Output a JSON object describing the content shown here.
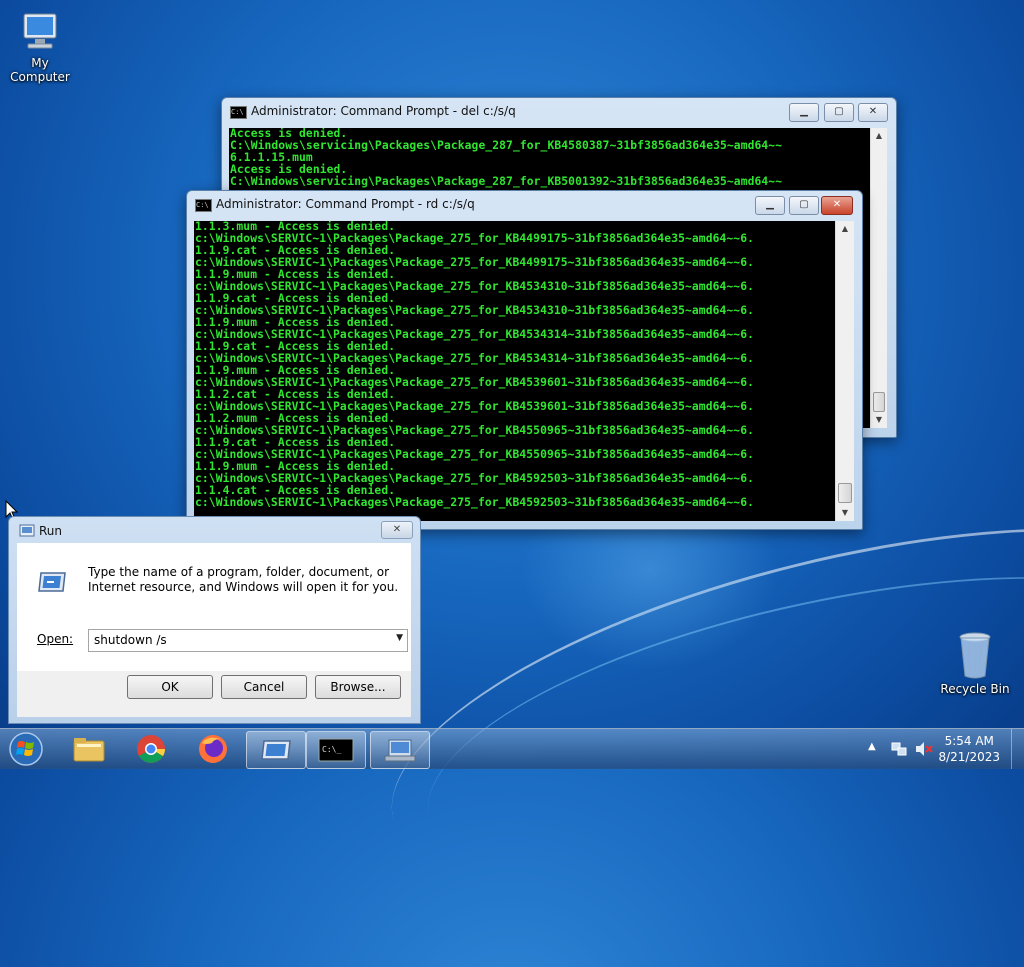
{
  "desktop": {
    "icons": {
      "my_computer": "My Computer",
      "recycle_bin": "Recycle Bin"
    }
  },
  "back_console": {
    "title": "Administrator:  Command Prompt - del  c:/s/q",
    "lines": [
      "Access is denied.",
      "C:\\Windows\\servicing\\Packages\\Package_287_for_KB4580387~31bf3856ad364e35~amd64~~",
      "6.1.1.15.mum",
      "Access is denied.",
      "C:\\Windows\\servicing\\Packages\\Package_287_for_KB5001392~31bf3856ad364e35~amd64~~"
    ]
  },
  "front_console": {
    "title": "Administrator:  Command Prompt - rd  c:/s/q",
    "lines": [
      "1.1.3.mum - Access is denied.",
      "c:\\Windows\\SERVIC~1\\Packages\\Package_275_for_KB4499175~31bf3856ad364e35~amd64~~6.",
      "1.1.9.cat - Access is denied.",
      "c:\\Windows\\SERVIC~1\\Packages\\Package_275_for_KB4499175~31bf3856ad364e35~amd64~~6.",
      "1.1.9.mum - Access is denied.",
      "c:\\Windows\\SERVIC~1\\Packages\\Package_275_for_KB4534310~31bf3856ad364e35~amd64~~6.",
      "1.1.9.cat - Access is denied.",
      "c:\\Windows\\SERVIC~1\\Packages\\Package_275_for_KB4534310~31bf3856ad364e35~amd64~~6.",
      "1.1.9.mum - Access is denied.",
      "c:\\Windows\\SERVIC~1\\Packages\\Package_275_for_KB4534314~31bf3856ad364e35~amd64~~6.",
      "1.1.9.cat - Access is denied.",
      "c:\\Windows\\SERVIC~1\\Packages\\Package_275_for_KB4534314~31bf3856ad364e35~amd64~~6.",
      "1.1.9.mum - Access is denied.",
      "c:\\Windows\\SERVIC~1\\Packages\\Package_275_for_KB4539601~31bf3856ad364e35~amd64~~6.",
      "1.1.2.cat - Access is denied.",
      "c:\\Windows\\SERVIC~1\\Packages\\Package_275_for_KB4539601~31bf3856ad364e35~amd64~~6.",
      "1.1.2.mum - Access is denied.",
      "c:\\Windows\\SERVIC~1\\Packages\\Package_275_for_KB4550965~31bf3856ad364e35~amd64~~6.",
      "1.1.9.cat - Access is denied.",
      "c:\\Windows\\SERVIC~1\\Packages\\Package_275_for_KB4550965~31bf3856ad364e35~amd64~~6.",
      "1.1.9.mum - Access is denied.",
      "c:\\Windows\\SERVIC~1\\Packages\\Package_275_for_KB4592503~31bf3856ad364e35~amd64~~6.",
      "1.1.4.cat - Access is denied.",
      "c:\\Windows\\SERVIC~1\\Packages\\Package_275_for_KB4592503~31bf3856ad364e35~amd64~~6."
    ]
  },
  "run_dialog": {
    "title": "Run",
    "description": "Type the name of a program, folder, document, or Internet resource, and Windows will open it for you.",
    "open_label": "Open:",
    "open_value": "shutdown /s",
    "ok_label": "OK",
    "cancel_label": "Cancel",
    "browse_label": "Browse..."
  },
  "window_buttons": {
    "close_glyph": "✕"
  },
  "taskbar": {
    "items": [
      "start-orb",
      "explorer",
      "chrome",
      "firefox",
      "run",
      "cmd",
      "network-app"
    ],
    "clock": {
      "time": "5:54 AM",
      "date": "8/21/2023"
    }
  },
  "colors": {
    "console_text": "#31e631",
    "console_bg": "#000000",
    "accent": "#1767bf"
  }
}
